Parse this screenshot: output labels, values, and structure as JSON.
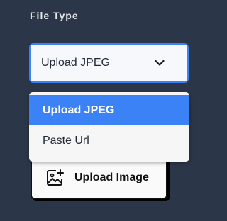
{
  "field": {
    "label": "File Type"
  },
  "select": {
    "value": "Upload JPEG",
    "icon": "chevron-down-icon"
  },
  "dropdown": {
    "options": [
      {
        "label": "Upload JPEG",
        "selected": true
      },
      {
        "label": "Paste Url",
        "selected": false
      }
    ],
    "selected_color": "#3b82f6"
  },
  "upload": {
    "label": "Upload Image",
    "icon": "image-add-icon"
  },
  "colors": {
    "background": "#2b3748",
    "accent": "#3b82f6"
  }
}
